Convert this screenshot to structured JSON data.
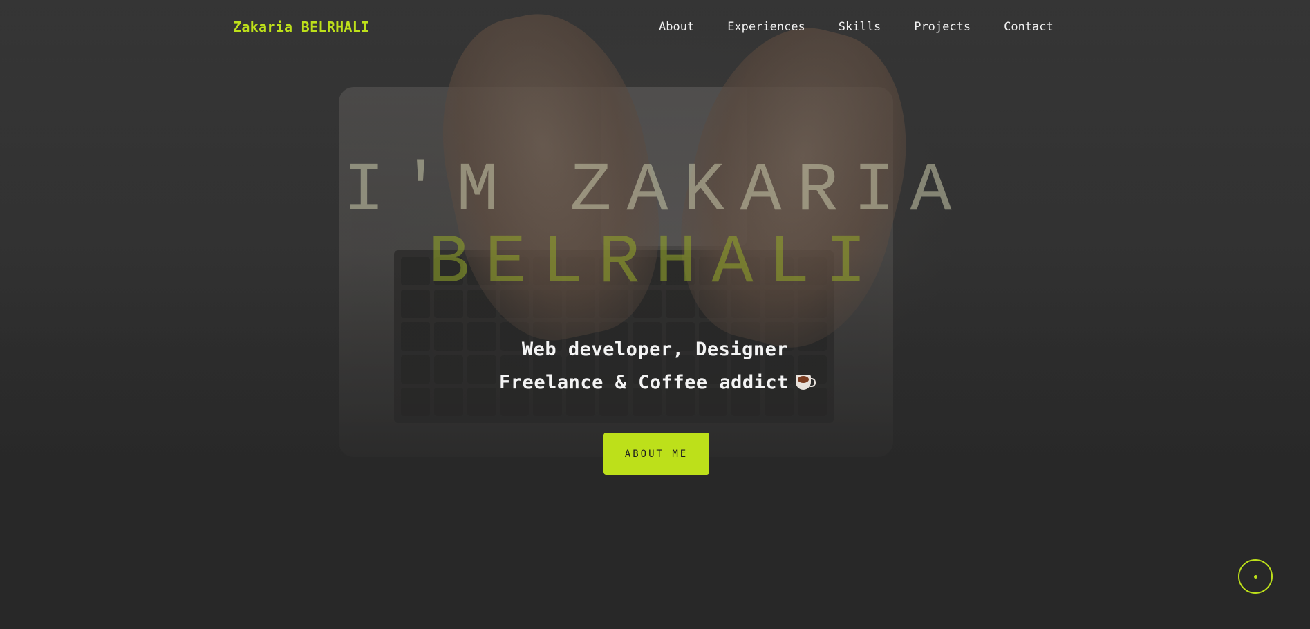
{
  "header": {
    "logo": "Zakaria BELRHALI",
    "nav": [
      "About",
      "Experiences",
      "Skills",
      "Projects",
      "Contact"
    ]
  },
  "hero": {
    "title_line1": "I'M ZAKARIA",
    "title_line2": "BELRHALI",
    "subtitle_line1": "Web developer, Designer",
    "subtitle_line2": "Freelance & Coffee addict",
    "subtitle_icon": "coffee-icon",
    "cta_label": "ABOUT ME"
  },
  "scroll_button": {
    "icon": "scroll-indicator-icon"
  },
  "colors": {
    "accent": "#bde01a",
    "background": "#282828",
    "text": "#ffffff"
  }
}
